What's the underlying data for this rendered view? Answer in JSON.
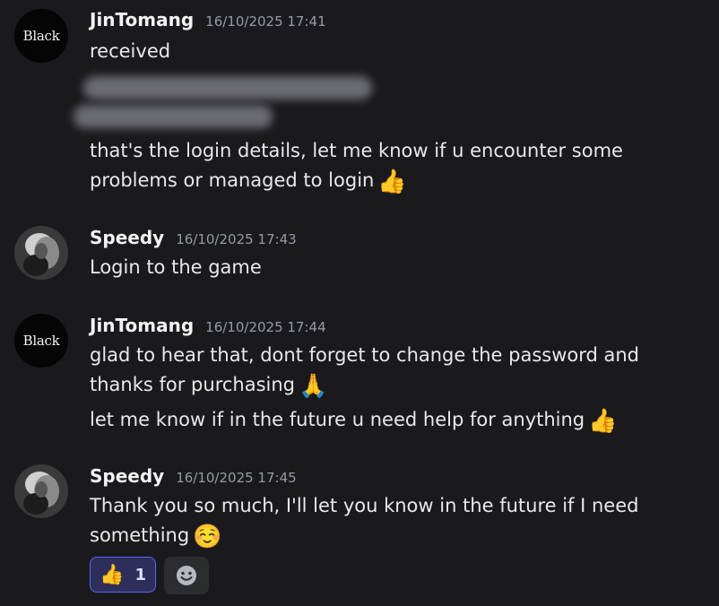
{
  "messages": [
    {
      "author": "JinTomang",
      "timestamp": "16/10/2025 17:41",
      "avatar_text": "Black",
      "lines": [
        "received"
      ],
      "redacted_lines": 2,
      "extra_text": "that's the login details, let me know if u encounter some problems or managed to login",
      "extra_emoji": "👍"
    },
    {
      "author": "Speedy",
      "timestamp": "16/10/2025 17:43",
      "text": "Login to the game"
    },
    {
      "author": "JinTomang",
      "timestamp": "16/10/2025 17:44",
      "avatar_text": "Black",
      "text1": "glad to hear that, dont forget to change the password and thanks for purchasing",
      "emoji1": "🙏",
      "text2": "let me know if in the future u need help for anything",
      "emoji2": "👍"
    },
    {
      "author": "Speedy",
      "timestamp": "16/10/2025 17:45",
      "text": "Thank you so much, I'll let you know in the future if I need something",
      "emoji": "☺️",
      "reactions": [
        {
          "emoji": "👍",
          "count": "1"
        }
      ]
    }
  ],
  "colors": {
    "background": "#1a1a1e",
    "username": "#f2f3f5",
    "timestamp": "#949ba4",
    "reaction_bg": "#2d2f5a",
    "reaction_border": "#5865f2"
  }
}
